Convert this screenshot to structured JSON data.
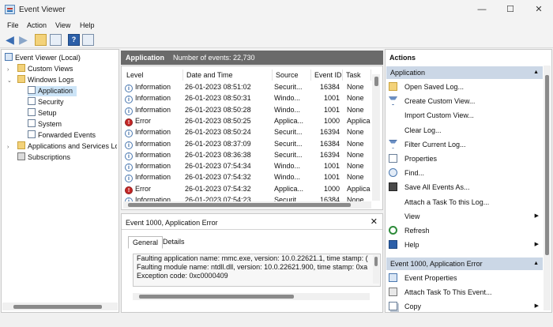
{
  "window": {
    "title": "Event Viewer",
    "minimize": "—",
    "maximize": "☐",
    "close": "✕"
  },
  "menu": [
    "File",
    "Action",
    "View",
    "Help"
  ],
  "tree": {
    "root": "Event Viewer (Local)",
    "custom_views": "Custom Views",
    "windows_logs": "Windows Logs",
    "logs": [
      "Application",
      "Security",
      "Setup",
      "System",
      "Forwarded Events"
    ],
    "apps_services": "Applications and Services Log",
    "subscriptions": "Subscriptions",
    "selected": "Application"
  },
  "center": {
    "log_name": "Application",
    "count_label": "Number of events: 22,730",
    "columns": [
      "Level",
      "Date and Time",
      "Source",
      "Event ID",
      "Task Ca"
    ],
    "rows": [
      {
        "level": "Information",
        "type": "info",
        "date": "26-01-2023 08:51:02",
        "source": "Securit...",
        "id": "16384",
        "task": "None"
      },
      {
        "level": "Information",
        "type": "info",
        "date": "26-01-2023 08:50:31",
        "source": "Windo...",
        "id": "1001",
        "task": "None"
      },
      {
        "level": "Information",
        "type": "info",
        "date": "26-01-2023 08:50:28",
        "source": "Windo...",
        "id": "1001",
        "task": "None"
      },
      {
        "level": "Error",
        "type": "error",
        "date": "26-01-2023 08:50:25",
        "source": "Applica...",
        "id": "1000",
        "task": "Applica"
      },
      {
        "level": "Information",
        "type": "info",
        "date": "26-01-2023 08:50:24",
        "source": "Securit...",
        "id": "16394",
        "task": "None"
      },
      {
        "level": "Information",
        "type": "info",
        "date": "26-01-2023 08:37:09",
        "source": "Securit...",
        "id": "16384",
        "task": "None"
      },
      {
        "level": "Information",
        "type": "info",
        "date": "26-01-2023 08:36:38",
        "source": "Securit...",
        "id": "16394",
        "task": "None"
      },
      {
        "level": "Information",
        "type": "info",
        "date": "26-01-2023 07:54:34",
        "source": "Windo...",
        "id": "1001",
        "task": "None"
      },
      {
        "level": "Information",
        "type": "info",
        "date": "26-01-2023 07:54:32",
        "source": "Windo...",
        "id": "1001",
        "task": "None"
      },
      {
        "level": "Error",
        "type": "error",
        "date": "26-01-2023 07:54:32",
        "source": "Applica...",
        "id": "1000",
        "task": "Applica"
      },
      {
        "level": "Information",
        "type": "info",
        "date": "26-01-2023 07:54:23",
        "source": "Securit...",
        "id": "16384",
        "task": "None"
      }
    ]
  },
  "detail": {
    "title": "Event 1000, Application Error",
    "close": "✕",
    "tabs": [
      "General",
      "Details"
    ],
    "lines": [
      "Faulting application name: mmc.exe, version: 10.0.22621.1, time stamp: (",
      "Faulting module name: ntdll.dll, version: 10.0.22621.900, time stamp: 0xa",
      "Exception code: 0xc0000409"
    ]
  },
  "actions": {
    "header": "Actions",
    "section1": "Application",
    "items1": [
      {
        "label": "Open Saved Log...",
        "icon": "open-folder-icon",
        "submenu": false
      },
      {
        "label": "Create Custom View...",
        "icon": "filter-icon",
        "submenu": false
      },
      {
        "label": "Import Custom View...",
        "icon": "none",
        "submenu": false
      },
      {
        "label": "Clear Log...",
        "icon": "none",
        "submenu": false
      },
      {
        "label": "Filter Current Log...",
        "icon": "filter-icon",
        "submenu": false
      },
      {
        "label": "Properties",
        "icon": "properties-icon",
        "submenu": false
      },
      {
        "label": "Find...",
        "icon": "find-icon",
        "submenu": false
      },
      {
        "label": "Save All Events As...",
        "icon": "save-icon",
        "submenu": false
      },
      {
        "label": "Attach a Task To this Log...",
        "icon": "none",
        "submenu": false
      },
      {
        "label": "View",
        "icon": "none",
        "submenu": true
      },
      {
        "label": "Refresh",
        "icon": "refresh-icon",
        "submenu": false
      },
      {
        "label": "Help",
        "icon": "help-icon",
        "submenu": true
      }
    ],
    "section2": "Event 1000, Application Error",
    "items2": [
      {
        "label": "Event Properties",
        "icon": "event-properties-icon",
        "submenu": false
      },
      {
        "label": "Attach Task To This Event...",
        "icon": "task-icon",
        "submenu": false
      },
      {
        "label": "Copy",
        "icon": "copy-icon",
        "submenu": true
      }
    ]
  },
  "colors": {
    "header_bg": "#6a6a6a",
    "section_bg": "#cbd7e6",
    "error": "#c62828",
    "info": "#4a78b0",
    "selection": "#cce4f7"
  }
}
